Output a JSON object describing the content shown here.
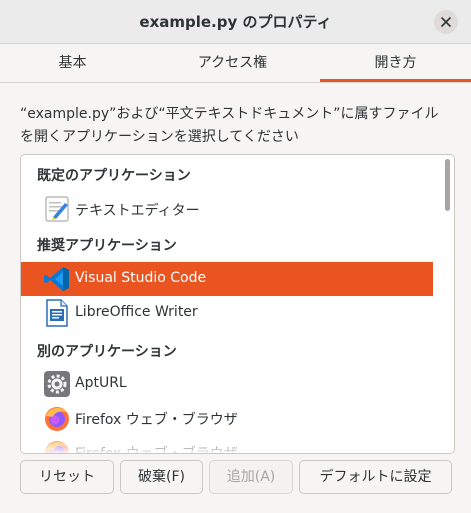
{
  "window": {
    "title": "example.py のプロパティ"
  },
  "tabs": [
    {
      "label": "基本",
      "active": false
    },
    {
      "label": "アクセス権",
      "active": false
    },
    {
      "label": "開き方",
      "active": true
    }
  ],
  "description": {
    "line1": "“example.py”および“平文テキストドキュメント”に属すファイル",
    "line2": "を開くアプリケーションを選択してください"
  },
  "sections": {
    "default": "既定のアプリケーション",
    "recommended": "推奨アプリケーション",
    "other": "別のアプリケーション"
  },
  "apps": {
    "text_editor": {
      "label": "テキストエディター",
      "icon": "text-editor-icon"
    },
    "vscode": {
      "label": "Visual Studio Code",
      "icon": "vscode-icon",
      "selected": true
    },
    "writer": {
      "label": "LibreOffice Writer",
      "icon": "libreoffice-writer-icon"
    },
    "apturl": {
      "label": "AptURL",
      "icon": "apturl-gear-icon"
    },
    "firefox1": {
      "label": "Firefox ウェブ・ブラウザ",
      "icon": "firefox-icon"
    },
    "firefox2": {
      "label": "Firefox ウェブ・ブラウザ",
      "icon": "firefox-icon"
    }
  },
  "buttons": {
    "reset": "リセット",
    "discard": "破棄(F)",
    "add": "追加(A)",
    "set_default": "デフォルトに設定"
  },
  "colors": {
    "accent": "#e95420",
    "background": "#f6f5f4"
  }
}
